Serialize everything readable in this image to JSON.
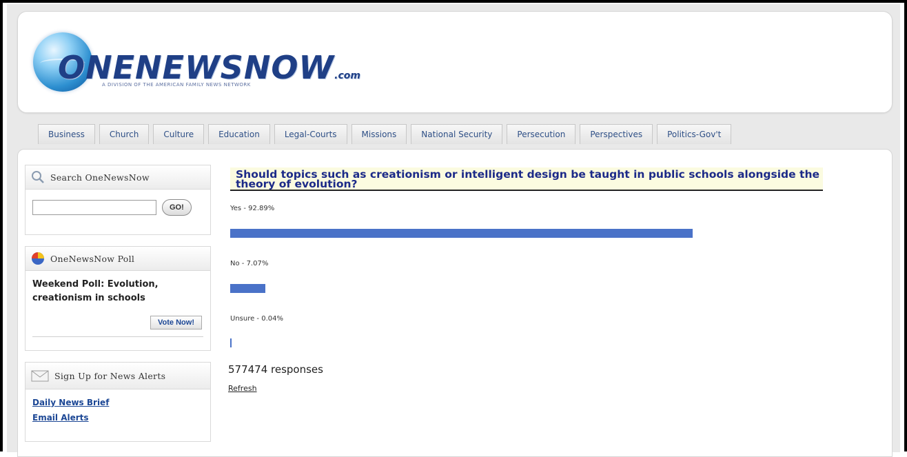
{
  "header": {
    "logo_text": "ONENEWSNOW",
    "logo_suffix": ".com",
    "logo_tagline": "A DIVISION OF THE AMERICAN FAMILY NEWS NETWORK"
  },
  "tabs": [
    {
      "label": "Business"
    },
    {
      "label": "Church"
    },
    {
      "label": "Culture"
    },
    {
      "label": "Education"
    },
    {
      "label": "Legal-Courts"
    },
    {
      "label": "Missions"
    },
    {
      "label": "National Security"
    },
    {
      "label": "Persecution"
    },
    {
      "label": "Perspectives"
    },
    {
      "label": "Politics-Gov't"
    }
  ],
  "sidebar": {
    "search": {
      "title": "Search OneNewsNow",
      "value": "",
      "go_label": "GO!"
    },
    "poll": {
      "title": "OneNewsNow Poll",
      "text": "Weekend Poll: Evolution, creationism in schools",
      "vote_label": "Vote Now!"
    },
    "alerts": {
      "title": "Sign Up for News Alerts",
      "links": [
        "Daily News Brief",
        "Email Alerts"
      ]
    }
  },
  "main": {
    "question": "Should topics such as creationism or intelligent design be taught in public schools alongside the theory of evolution?",
    "results": [
      {
        "label": "Yes - 92.89%",
        "percent": 92.89
      },
      {
        "label": "No - 7.07%",
        "percent": 7.07
      },
      {
        "label": "Unsure - 0.04%",
        "percent": 0.04
      }
    ],
    "responses": "577474 responses",
    "refresh": "Refresh"
  },
  "colors": {
    "bar": "#4a72c8",
    "link": "#1c4795",
    "question_bg": "#fbfbe0"
  }
}
